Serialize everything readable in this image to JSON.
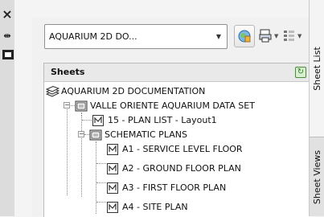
{
  "palette": {
    "tool_strip": "#dcdcdc",
    "panel": "#f1f1f1",
    "tree_background": "#ffffff",
    "refresh_green": "#2f7d22"
  },
  "toolbar": {
    "sheet_set_combo": {
      "value": "AQUARIUM 2D DO...",
      "icon": "chevron-down-icon"
    },
    "buttons": [
      {
        "icon": "sheet-set-globe-icon"
      },
      {
        "icon": "publish-icon",
        "has_dropdown": true
      },
      {
        "icon": "sheet-selections-icon",
        "has_dropdown": true
      }
    ]
  },
  "tree": {
    "header": {
      "title": "Sheets",
      "refresh_icon": "refresh-icon",
      "refresh_glyph": "↻"
    },
    "root": {
      "label": "AQUARIUM 2D DOCUMENTATION",
      "icon": "sheet-set-icon"
    },
    "items": [
      {
        "label": "VALLE ORIENTE AQUARIUM DATA SET",
        "icon": "subset-icon",
        "toggle": "−"
      },
      {
        "label": "15 - PLAN LIST - Layout1",
        "icon": "sheet-icon"
      },
      {
        "label": "SCHEMATIC PLANS",
        "icon": "subset-icon",
        "toggle": "−"
      },
      {
        "label": "A1 - SERVICE LEVEL FLOOR",
        "icon": "sheet-icon"
      },
      {
        "label": "A2 - GROUND FLOOR PLAN",
        "icon": "sheet-icon"
      },
      {
        "label": "A3 - FIRST FLOOR PLAN",
        "icon": "sheet-icon"
      },
      {
        "label": "A4 - SITE PLAN",
        "icon": "sheet-icon"
      }
    ]
  },
  "left_strip": {
    "close_glyph": "×",
    "close_icon": "close-icon",
    "autohide_glyph": "⇹",
    "autohide_icon": "autohide-icon",
    "properties_icon": "properties-icon"
  },
  "vertical_tabs": [
    {
      "label": "Sheet List",
      "active": true
    },
    {
      "label": "Sheet Views",
      "active": false
    }
  ]
}
